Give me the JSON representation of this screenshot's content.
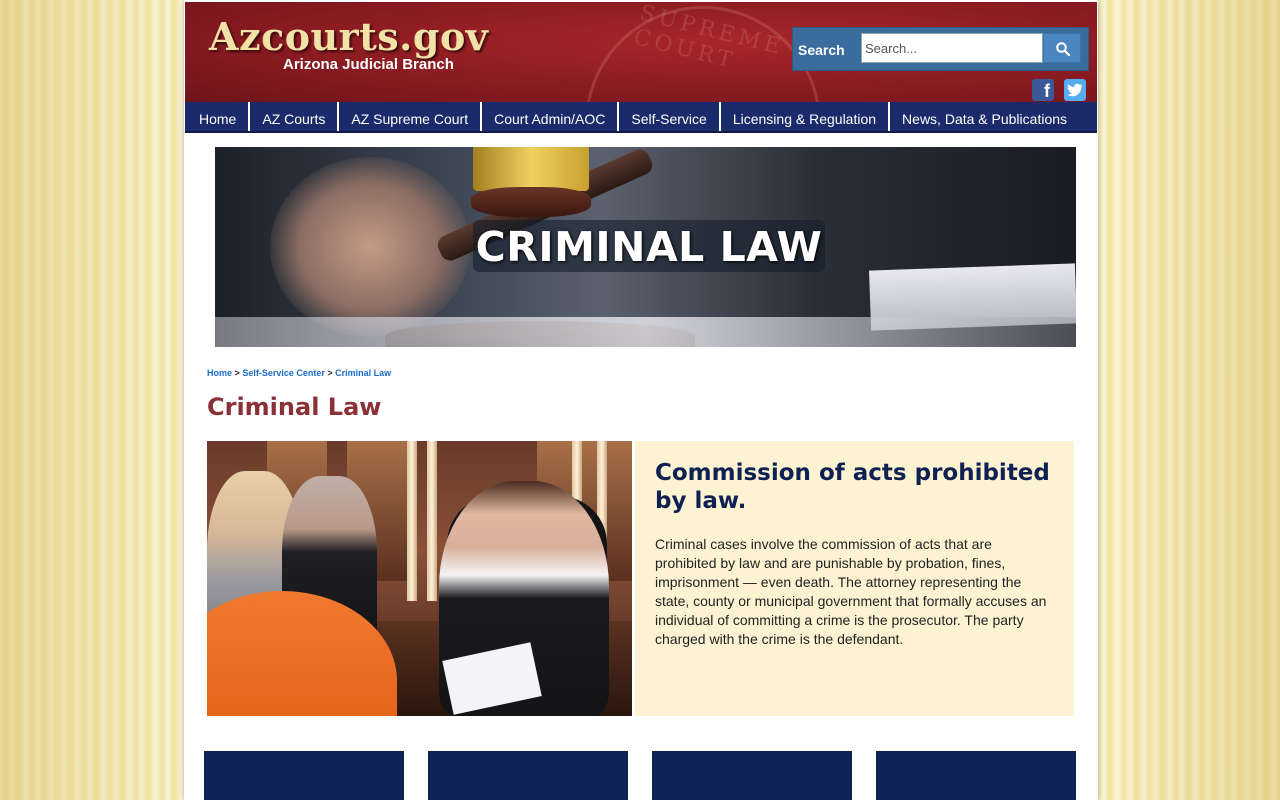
{
  "header": {
    "site_title": "Azcourts.gov",
    "site_subtitle": "Arizona Judicial Branch",
    "seal_text": "SUPREME COURT"
  },
  "search": {
    "label": "Search",
    "placeholder": "Search...",
    "button_icon": "search-icon"
  },
  "social": [
    {
      "name": "facebook-icon",
      "glyph": "f"
    },
    {
      "name": "twitter-icon"
    }
  ],
  "nav": {
    "items": [
      {
        "label": "Home"
      },
      {
        "label": "AZ Courts"
      },
      {
        "label": "AZ Supreme Court"
      },
      {
        "label": "Court Admin/AOC"
      },
      {
        "label": "Self-Service"
      },
      {
        "label": "Licensing & Regulation"
      },
      {
        "label": "News, Data & Publications"
      }
    ]
  },
  "hero": {
    "title": "CRIMINAL LAW"
  },
  "breadcrumb": {
    "items": [
      "Home",
      "Self-Service Center",
      "Criminal Law"
    ],
    "separator": ">"
  },
  "page": {
    "title": "Criminal Law"
  },
  "info": {
    "heading": "Commission of acts prohibited by law.",
    "body": "Criminal cases involve the commission of acts that are prohibited by law and are punishable by probation, fines, imprisonment — even death. The attorney representing the state, county or municipal government that formally accuses an individual of committing a crime is the prosecutor. The party charged with the crime is the defendant."
  },
  "colors": {
    "header_red": "#8a1c22",
    "nav_blue": "#1a2a6a",
    "title_red": "#8a3036",
    "heading_navy": "#0f2152",
    "info_bg": "#fdf3d2",
    "link_blue": "#1a6cc8",
    "tile_navy": "#0d2154"
  }
}
